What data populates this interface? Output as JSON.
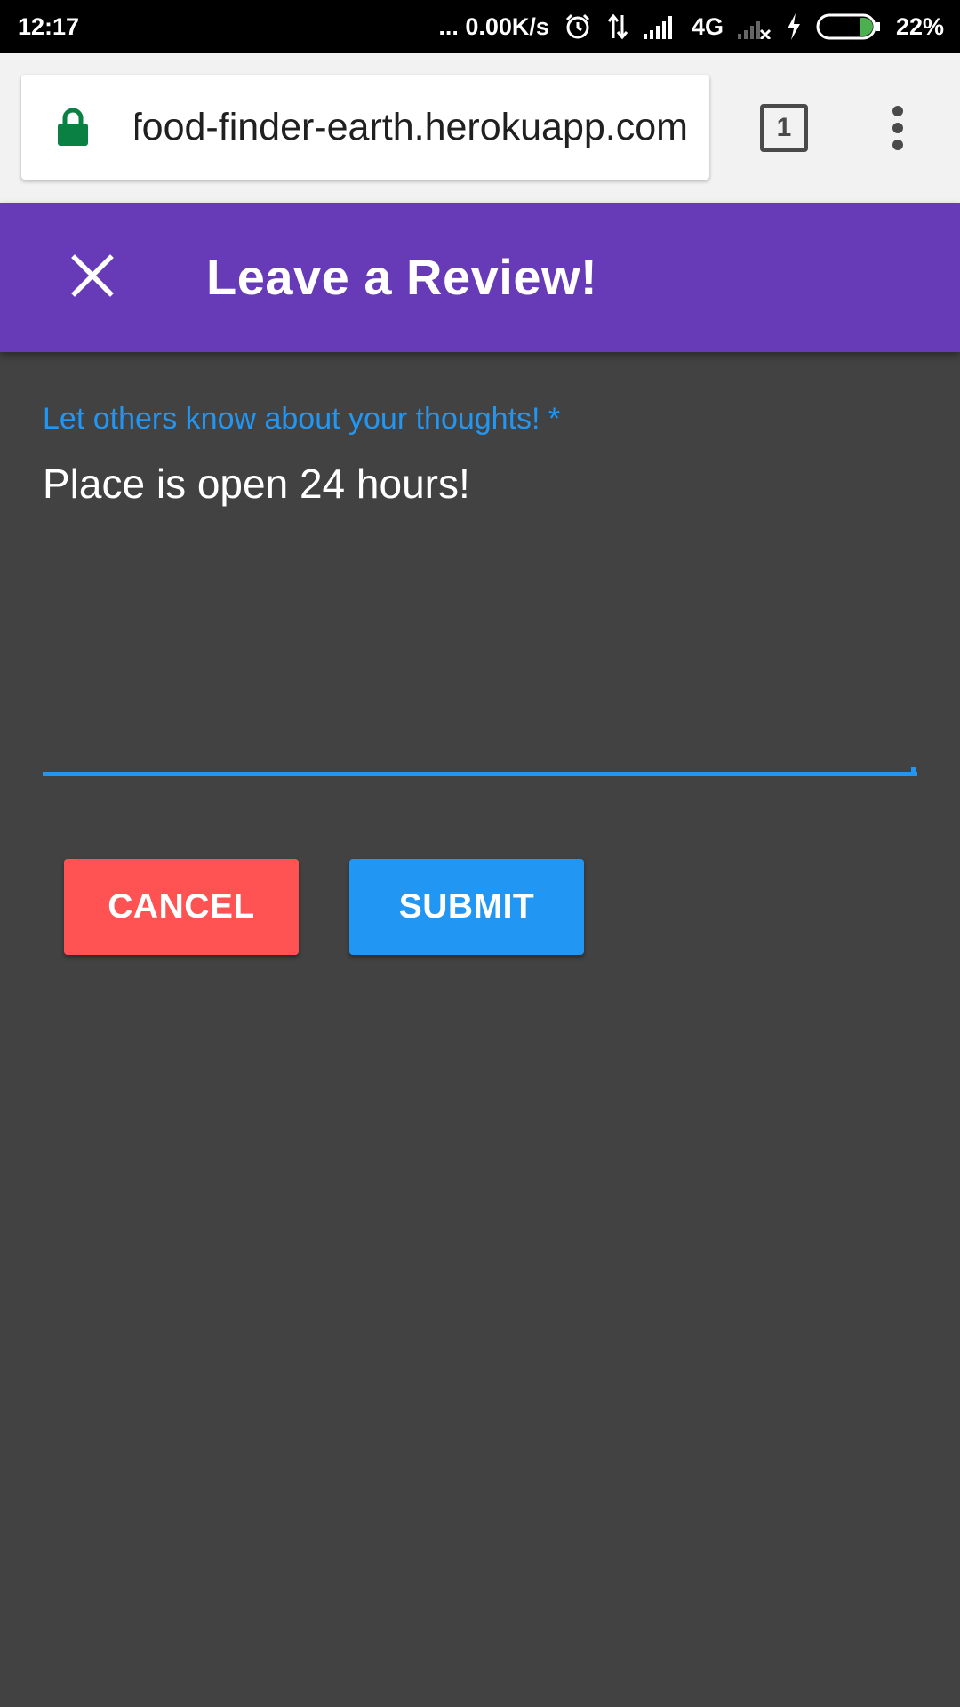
{
  "status_bar": {
    "time": "12:17",
    "network_speed": "... 0.00K/s",
    "network_type": "4G",
    "battery": "22%",
    "icons": [
      "alarm-icon",
      "data-transfer-icon",
      "signal-icon",
      "no-signal-icon",
      "charging-icon",
      "battery-icon"
    ]
  },
  "browser": {
    "url": "food-finder-earth.herokuapp.com",
    "tab_count": "1",
    "icons": [
      "lock-icon",
      "tab-switcher-icon",
      "more-vert-icon"
    ]
  },
  "header": {
    "title": "Leave a Review!",
    "close_icon": "close-icon",
    "background_color": "#673ab7"
  },
  "form": {
    "label": "Let others know about your thoughts! *",
    "value": "Place is open 24 hours!",
    "cancel_label": "CANCEL",
    "submit_label": "SUBMIT",
    "accent_color": "#2196f3",
    "cancel_color": "#ff5252"
  }
}
